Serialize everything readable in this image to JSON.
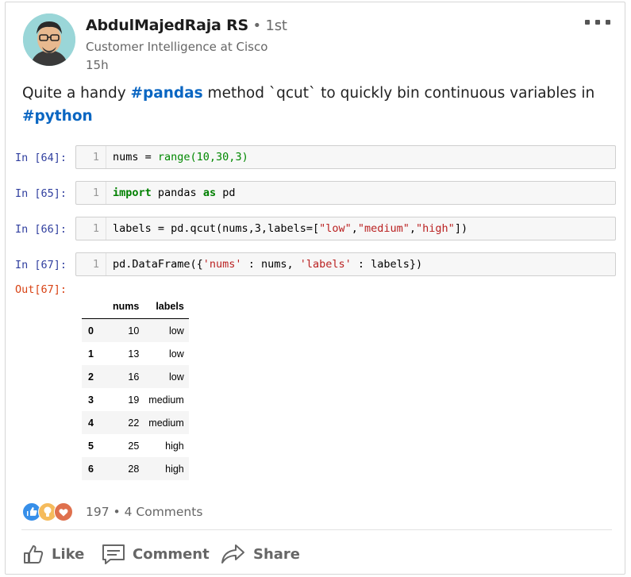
{
  "post": {
    "author": "AbdulMajedRaja RS",
    "degree": " • 1st",
    "headline": "Customer Intelligence at Cisco",
    "time": "15h",
    "text_before": "Quite a handy ",
    "hashtag1": "#pandas",
    "text_middle": " method `qcut` to quickly bin continuous variables in ",
    "hashtag2": "#python"
  },
  "notebook": {
    "cells": [
      {
        "prompt": "In [64]:",
        "line": "1"
      },
      {
        "prompt": "In [65]:",
        "line": "1"
      },
      {
        "prompt": "In [66]:",
        "line": "1"
      },
      {
        "prompt": "In [67]:",
        "line": "1"
      }
    ],
    "code": {
      "c64": {
        "a": "nums = ",
        "b": "range(10,30,3)"
      },
      "c65": {
        "kw1": "import",
        "a": " pandas ",
        "kw2": "as",
        "b": " pd"
      },
      "c66": {
        "a": "labels = pd.qcut(nums,3,labels=[",
        "s1": "\"low\"",
        "c1": ",",
        "s2": "\"medium\"",
        "c2": ",",
        "s3": "\"high\"",
        "b": "])"
      },
      "c67": {
        "a": "pd.DataFrame({",
        "s1": "'nums'",
        "b": " : nums, ",
        "s2": "'labels'",
        "c": " : labels})"
      }
    },
    "out_prompt": "Out[67]:",
    "dataframe": {
      "columns": [
        "nums",
        "labels"
      ],
      "rows": [
        {
          "idx": "0",
          "nums": "10",
          "labels": "low"
        },
        {
          "idx": "1",
          "nums": "13",
          "labels": "low"
        },
        {
          "idx": "2",
          "nums": "16",
          "labels": "low"
        },
        {
          "idx": "3",
          "nums": "19",
          "labels": "medium"
        },
        {
          "idx": "4",
          "nums": "22",
          "labels": "medium"
        },
        {
          "idx": "5",
          "nums": "25",
          "labels": "high"
        },
        {
          "idx": "6",
          "nums": "28",
          "labels": "high"
        }
      ]
    }
  },
  "social": {
    "reaction_count": "197",
    "separator": " • ",
    "comments": "4 Comments",
    "reactions": [
      "like-icon",
      "insightful-icon",
      "love-icon"
    ],
    "colors": {
      "like": "#378fe9",
      "insightful": "#f5bb5c",
      "love": "#df704d"
    }
  },
  "actions": {
    "like": "Like",
    "comment": "Comment",
    "share": "Share"
  }
}
